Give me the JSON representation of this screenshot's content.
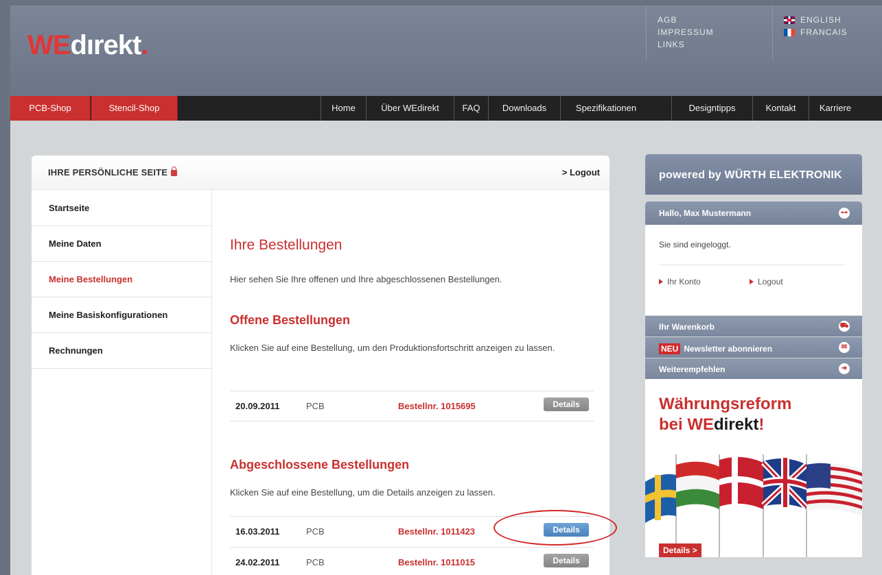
{
  "header": {
    "logo": {
      "we": "WE",
      "rest": "dırekt",
      "dot": "."
    },
    "toplinks": [
      "AGB",
      "IMPRESSUM",
      "LINKS"
    ],
    "languages": [
      {
        "label": "ENGLISH",
        "flag": "uk-flag-icon"
      },
      {
        "label": "FRANCAIS",
        "flag": "france-flag-icon"
      }
    ]
  },
  "nav": {
    "shops": [
      "PCB-Shop",
      "Stencil-Shop"
    ],
    "items": [
      "Home",
      "Über WEdirekt",
      "FAQ",
      "Downloads",
      "Spezifikationen",
      "Designtipps",
      "Kontakt",
      "Karriere"
    ]
  },
  "panel": {
    "title": "IHRE PERSÖNLICHE SEITE",
    "logout": "> Logout",
    "menu": [
      "Startseite",
      "Meine Daten",
      "Meine Bestellungen",
      "Meine Basiskonfigurationen",
      "Rechnungen"
    ],
    "heading": "Ihre Bestellungen",
    "intro": "Hier sehen Sie Ihre offenen und Ihre abgeschlossenen Bestellungen.",
    "open": {
      "heading": "Offene Bestellungen",
      "desc": "Klicken Sie auf eine Bestellung, um den Produktionsfortschritt anzeigen zu lassen.",
      "rows": [
        {
          "date": "20.09.2011",
          "type": "PCB",
          "number": "Bestellnr. 1015695",
          "action": "Details"
        }
      ]
    },
    "closed": {
      "heading": "Abgeschlossene Bestellungen",
      "desc": "Klicken Sie auf eine Bestellung, um die Details anzeigen zu lassen.",
      "rows": [
        {
          "date": "16.03.2011",
          "type": "PCB",
          "number": "Bestellnr. 1011423",
          "action": "Details"
        },
        {
          "date": "24.02.2011",
          "type": "PCB",
          "number": "Bestellnr. 1011015",
          "action": "Details"
        }
      ]
    }
  },
  "sidebar": {
    "powered": "powered by WÜRTH ELEKTRONIK",
    "greeting": "Hallo, Max Mustermann",
    "status": "Sie sind eingeloggt.",
    "account_link": "Ihr Konto",
    "logout_link": "Logout",
    "cart": "Ihr Warenkorb",
    "neu": "NEU",
    "newsletter": "Newsletter abonnieren",
    "recommend": "Weiterempfehlen",
    "promo_line1": "Währungsreform",
    "promo_line2_pre": "bei ",
    "promo_brand_we": "WE",
    "promo_brand_rest": "direkt",
    "promo_excl": "!",
    "promo_button": "Details >"
  },
  "colors": {
    "accent": "#c9302f",
    "navbar": "#222222",
    "header": "#737c8e",
    "highlight": "#4b82bd"
  }
}
